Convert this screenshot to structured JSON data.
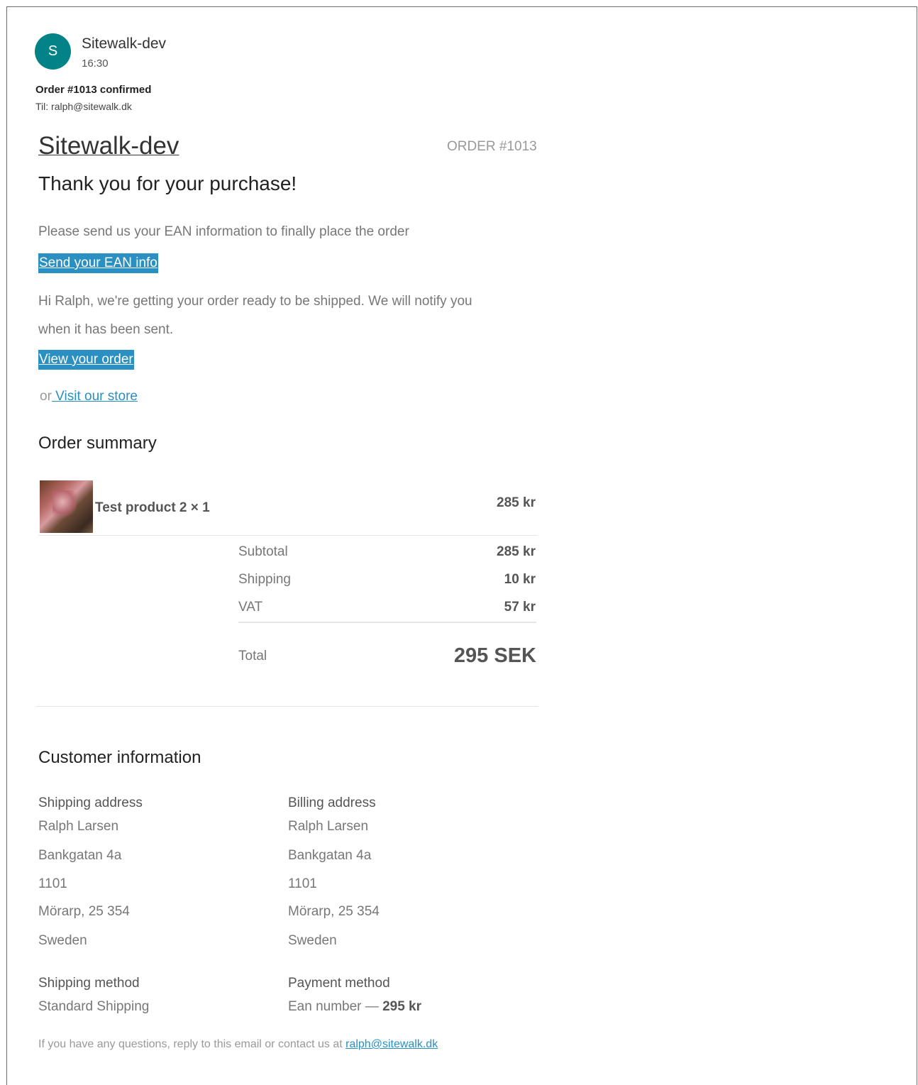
{
  "email": {
    "avatar_letter": "S",
    "sender": "Sitewalk-dev",
    "time": "16:30",
    "subject": "Order #1013 confirmed",
    "to_label": "Til:",
    "to_address": "ralph@sitewalk.dk"
  },
  "header": {
    "shop_name": "Sitewalk-dev",
    "order_number": "ORDER #1013",
    "thank_you": "Thank you for your purchase!"
  },
  "body": {
    "ean_text": "Please send us your EAN information to finally place the order",
    "ean_button": "Send your EAN info",
    "ready_line1": "Hi Ralph, we're getting your order ready to be shipped. We will notify you",
    "ready_line2": "when it has been sent.",
    "view_order_button": "View your order",
    "or_text": "or",
    "visit_store_link": " Visit our store"
  },
  "summary": {
    "title": "Order summary",
    "product": {
      "name": "Test product 2 × 1",
      "price": "285 kr"
    },
    "subtotal_label": "Subtotal",
    "subtotal_value": "285 kr",
    "shipping_label": "Shipping",
    "shipping_value": "10 kr",
    "vat_label": "VAT",
    "vat_value": "57 kr",
    "total_label": "Total",
    "total_value": "295 SEK"
  },
  "customer": {
    "title": "Customer information",
    "shipping_address_title": "Shipping address",
    "shipping_address": [
      "Ralph Larsen",
      "Bankgatan 4a",
      "1101",
      "Mörarp, 25 354",
      "Sweden"
    ],
    "billing_address_title": "Billing address",
    "billing_address": [
      "Ralph Larsen",
      "Bankgatan 4a",
      "1101",
      "Mörarp, 25 354",
      "Sweden"
    ],
    "shipping_method_title": "Shipping method",
    "shipping_method": "Standard Shipping",
    "payment_method_title": "Payment method",
    "payment_method": "Ean number — ",
    "payment_amount": "295 kr"
  },
  "footer": {
    "text": "If you have any questions, reply to this email or contact us at ",
    "email": "ralph@sitewalk.dk"
  },
  "colors": {
    "avatar": "#038387",
    "accent": "#2a8fc1"
  }
}
